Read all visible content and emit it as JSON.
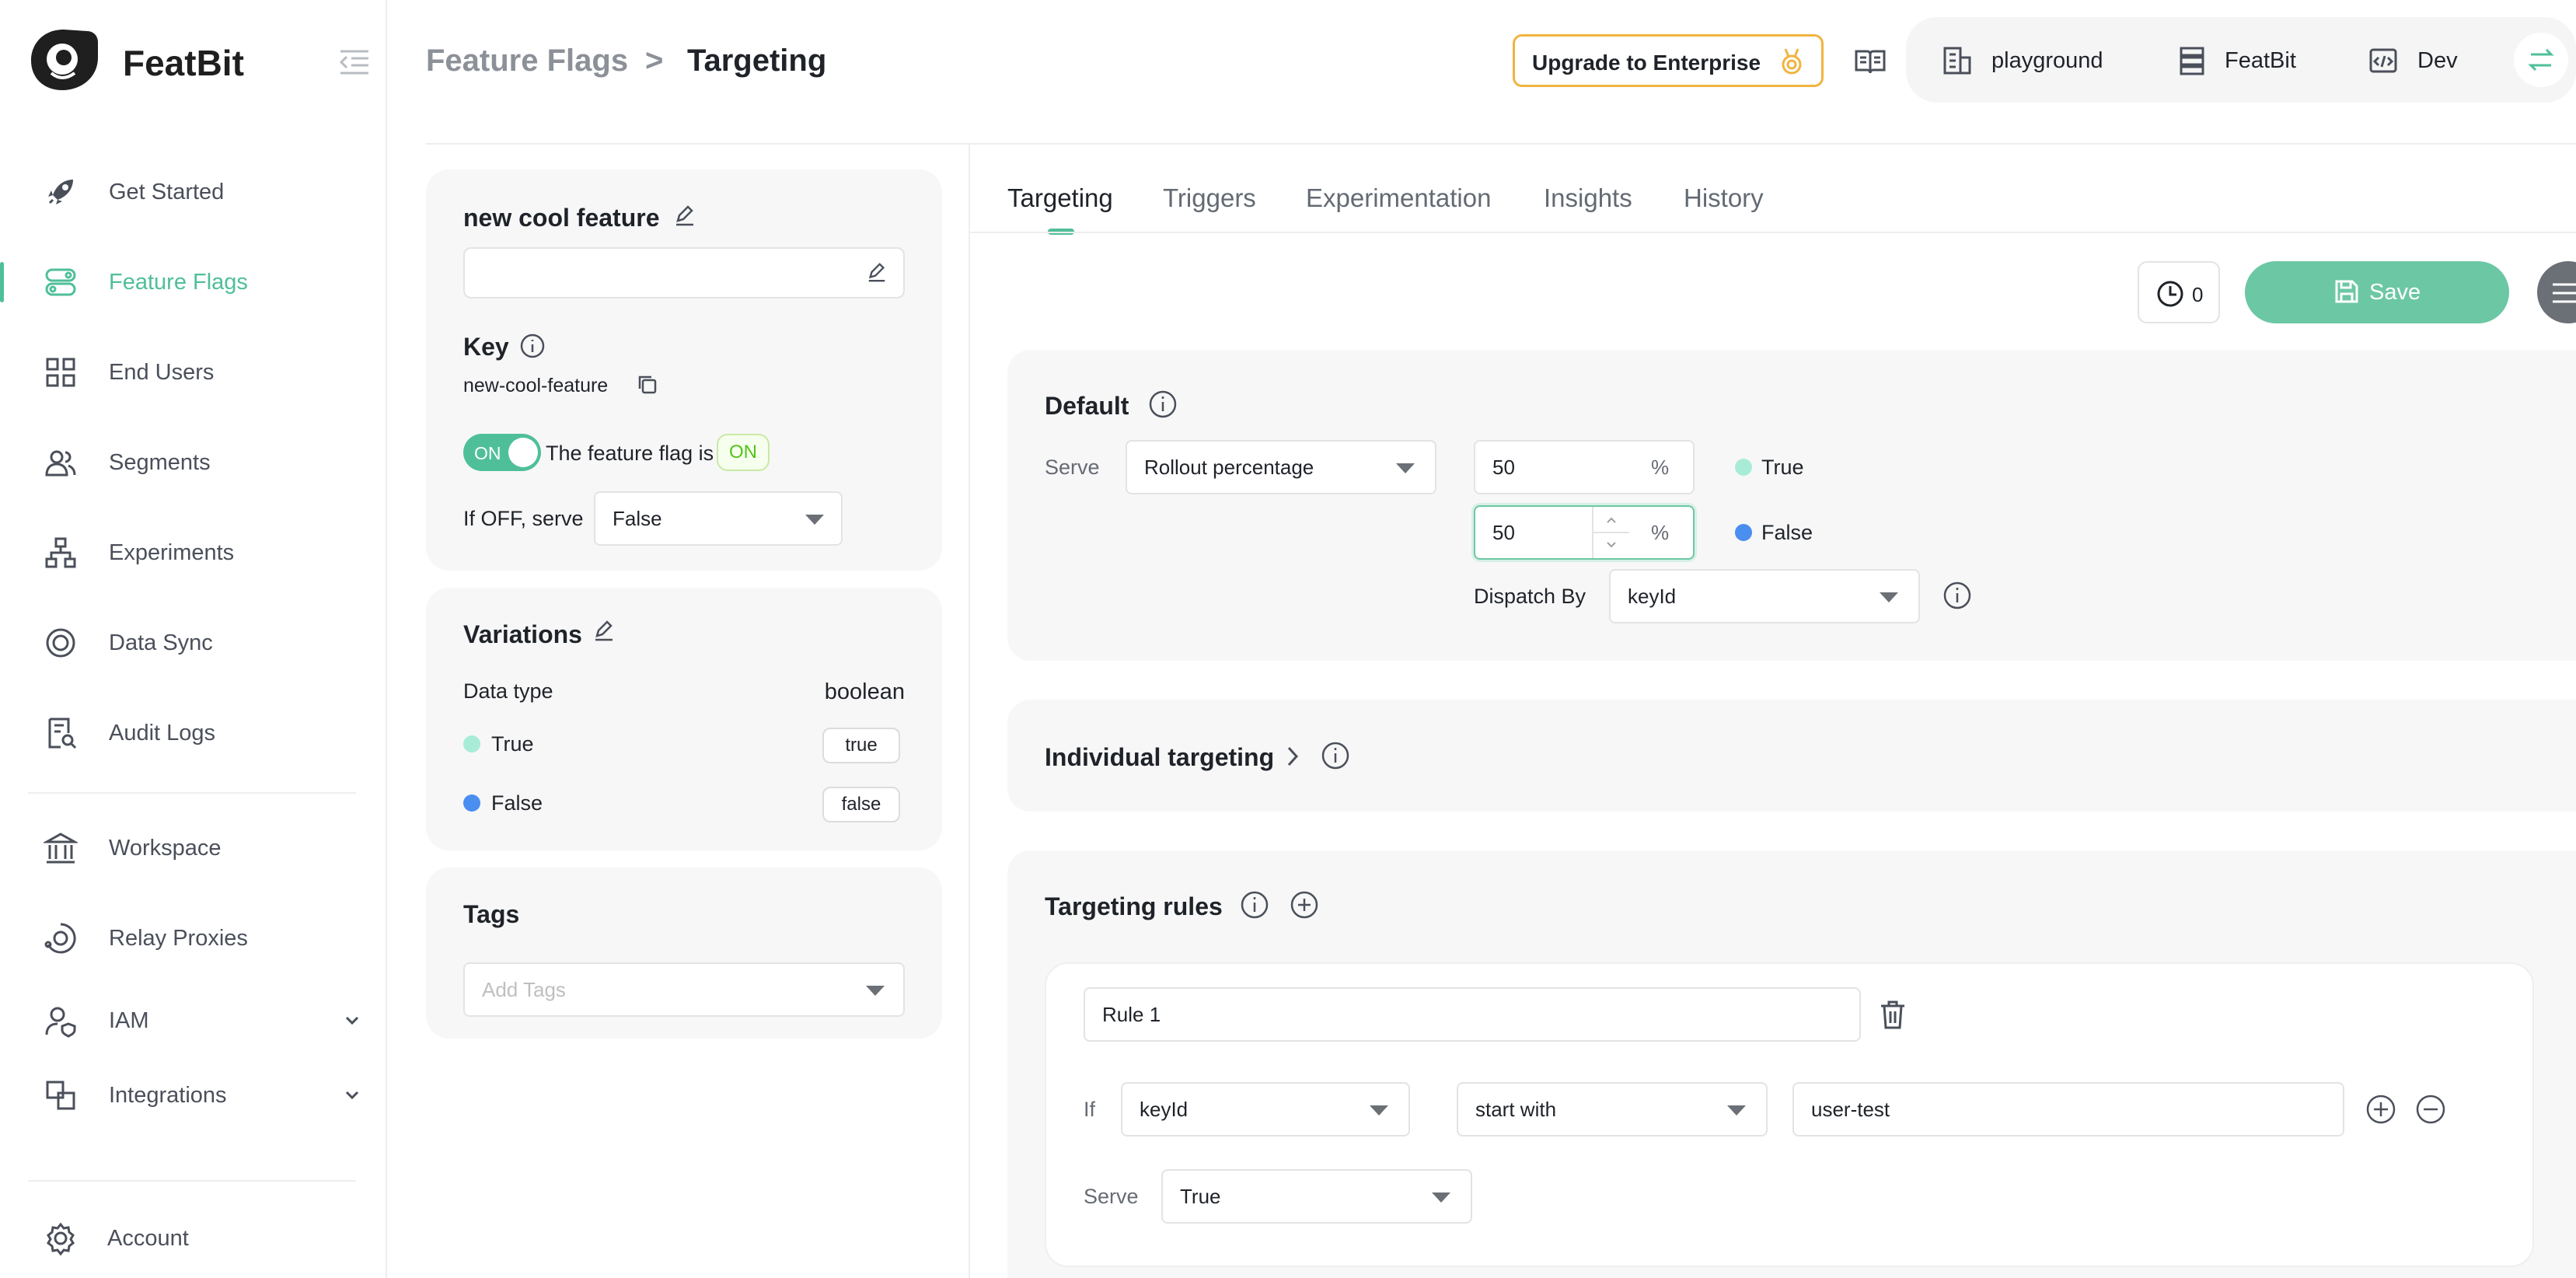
{
  "brand": {
    "name": "FeatBit"
  },
  "sidebar": {
    "items": [
      {
        "label": "Get Started",
        "icon": "rocket-icon"
      },
      {
        "label": "Feature Flags",
        "icon": "toggle-icon"
      },
      {
        "label": "End Users",
        "icon": "grid-icon"
      },
      {
        "label": "Segments",
        "icon": "users-icon"
      },
      {
        "label": "Experiments",
        "icon": "hierarchy-icon"
      },
      {
        "label": "Data Sync",
        "icon": "sync-icon"
      },
      {
        "label": "Audit Logs",
        "icon": "audit-icon"
      },
      {
        "label": "Workspace",
        "icon": "bank-icon"
      },
      {
        "label": "Relay Proxies",
        "icon": "proxy-icon"
      },
      {
        "label": "IAM",
        "icon": "user-shield-icon"
      },
      {
        "label": "Integrations",
        "icon": "integrations-icon"
      },
      {
        "label": "Account",
        "icon": "gear-icon"
      }
    ],
    "active": "Feature Flags"
  },
  "header": {
    "breadcrumb_parent": "Feature Flags",
    "breadcrumb_sep": ">",
    "breadcrumb_current": "Targeting",
    "upgrade_label": "Upgrade to Enterprise",
    "org": "playground",
    "project": "FeatBit",
    "env": "Dev"
  },
  "flag": {
    "name": "new cool feature",
    "description": "",
    "key_title": "Key",
    "key": "new-cool-feature",
    "toggle_label": "ON",
    "status_text": "The feature flag is",
    "status_badge": "ON",
    "off_serve_label": "If OFF, serve",
    "off_serve_value": "False"
  },
  "variations": {
    "title": "Variations",
    "data_type_label": "Data type",
    "data_type_value": "boolean",
    "items": [
      {
        "name": "True",
        "value": "true",
        "color": "#a8ecd8"
      },
      {
        "name": "False",
        "value": "false",
        "color": "#4a8ef0"
      }
    ]
  },
  "tags": {
    "title": "Tags",
    "placeholder": "Add Tags"
  },
  "tabs": [
    "Targeting",
    "Triggers",
    "Experimentation",
    "Insights",
    "History"
  ],
  "toolbar": {
    "schedule_count": "0",
    "save_label": "Save"
  },
  "default_rule": {
    "title": "Default",
    "serve_label": "Serve",
    "serve_value": "Rollout percentage",
    "rollout": [
      {
        "percent": "50",
        "variation": "True"
      },
      {
        "percent": "50",
        "variation": "False"
      }
    ],
    "percent_suffix": "%",
    "dispatch_label": "Dispatch By",
    "dispatch_value": "keyId"
  },
  "individual_targeting": {
    "title": "Individual targeting"
  },
  "targeting_rules": {
    "title": "Targeting rules",
    "rules": [
      {
        "name": "Rule 1",
        "if_label": "If",
        "attribute": "keyId",
        "operator": "start with",
        "value": "user-test",
        "serve_label": "Serve",
        "serve_value": "True"
      }
    ]
  },
  "colors": {
    "accent": "#4fbf9a",
    "upgrade_border": "#f0b440"
  }
}
